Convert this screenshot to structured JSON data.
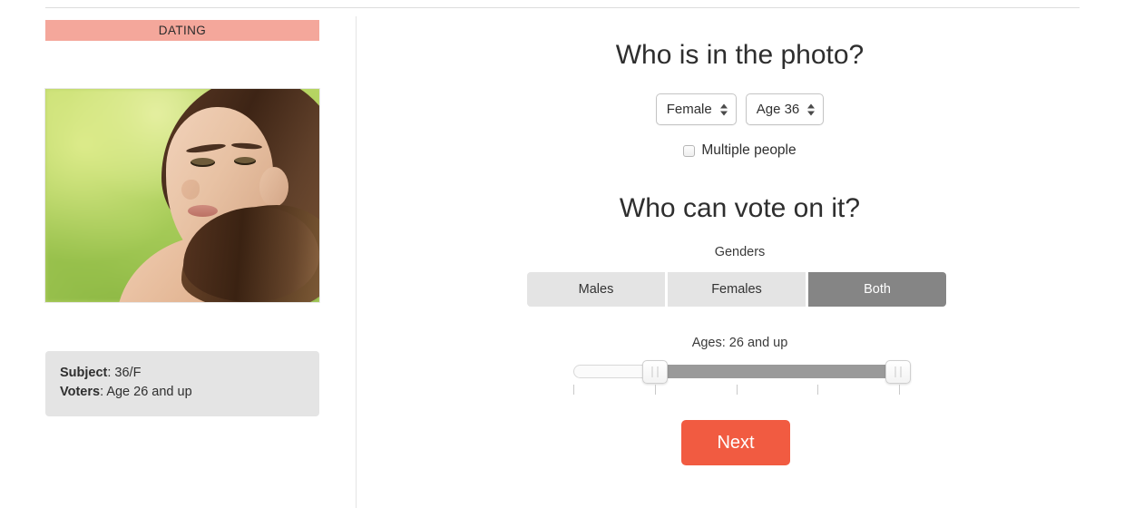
{
  "left_panel": {
    "category_banner": "DATING",
    "photo": {
      "alt": "portrait-of-woman-outdoors-green-background"
    },
    "info": {
      "subject_label": "Subject",
      "subject_value": ": 36/F",
      "voters_label": "Voters",
      "voters_value": ": Age 26 and up"
    }
  },
  "right_panel": {
    "photo_question": {
      "heading": "Who is in the photo?",
      "gender_select": {
        "value": "Female"
      },
      "age_select": {
        "value": "Age 36"
      },
      "multiple_people": {
        "label": "Multiple people",
        "checked": false
      }
    },
    "vote_question": {
      "heading": "Who can vote on it?",
      "genders_label": "Genders",
      "gender_options": [
        {
          "label": "Males",
          "selected": false
        },
        {
          "label": "Females",
          "selected": false
        },
        {
          "label": "Both",
          "selected": true
        }
      ],
      "ages_label": "Ages: 26 and up",
      "age_slider": {
        "min_value": 26,
        "max_value": "and up",
        "tick_count": 5
      }
    },
    "next_button": "Next"
  },
  "colors": {
    "banner": "#f4a79b",
    "accent_button": "#f15b41",
    "selected_toggle": "#858585",
    "unselected_toggle": "#e4e4e4",
    "info_box": "#e4e4e4",
    "slider_filled": "#9a9a9a"
  }
}
